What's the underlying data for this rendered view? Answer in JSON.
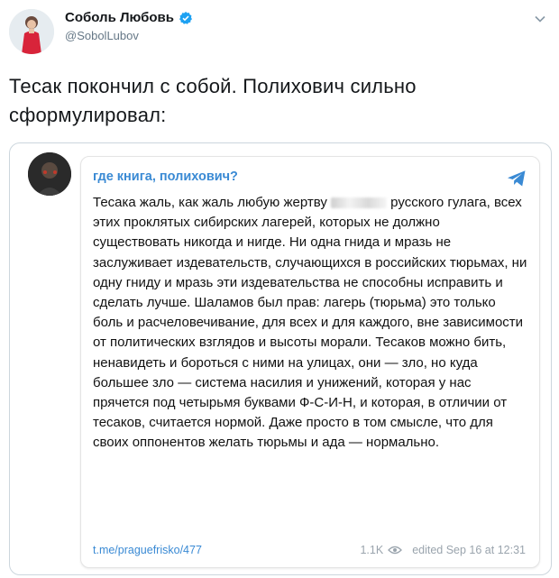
{
  "author": {
    "name": "Соболь Любовь",
    "handle": "@SobolLubov",
    "verified_color": "#1da1f2"
  },
  "tweet": {
    "text": "Тесак покончил с собой. Полихович сильно сформулировал:"
  },
  "embed": {
    "channel_name": "где книга, полихович?",
    "accent_color": "#3a8ad4",
    "body_before": "Тесака жаль, как жаль любую жертву ",
    "body_after": " русского гулага, всех этих проклятых сибирских лагерей, которых не должно существовать никогда и нигде. Ни одна гнида и мразь не заслуживает издевательств, случающихся в российских тюрьмах, ни одну гниду и мразь эти издевательства не способны исправить и сделать лучше. Шаламов был прав: лагерь (тюрьма) это только боль и расчеловечивание, для всех и для каждого, вне зависимости от политических взглядов и высоты морали. Тесаков можно бить, ненавидеть и бороться с ними на улицах, они — зло, но куда большее зло — система насилия и унижений, которая у нас прячется под четырьмя буквами Ф-С-И-Н, и которая, в отличии от тесаков, считается нормой. Даже просто в том смысле, что для своих оппонентов желать тюрьмы и ада — нормально.",
    "link": "t.me/praguefrisko/477",
    "views": "1.1K",
    "edited": "edited Sep 16 at 12:31"
  }
}
